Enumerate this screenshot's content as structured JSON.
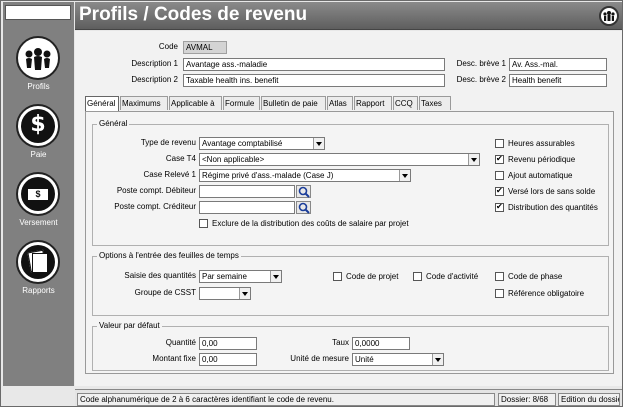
{
  "window": {
    "title": "Profils / Codes de revenu"
  },
  "sidebar": {
    "items": [
      {
        "label": "Profils",
        "icon": "people-icon"
      },
      {
        "label": "Paie",
        "icon": "dollar-icon"
      },
      {
        "label": "Versement",
        "icon": "banknote-icon"
      },
      {
        "label": "Rapports",
        "icon": "reports-icon"
      }
    ]
  },
  "header": {
    "code_label": "Code",
    "code_value": "AVMAL",
    "desc1_label": "Description 1",
    "desc1_value": "Avantage ass.-maladie",
    "desc2_label": "Description 2",
    "desc2_value": "Taxable health ins. benefit",
    "short1_label": "Desc. brève 1",
    "short1_value": "Av. Ass.-mal.",
    "short2_label": "Desc. brève 2",
    "short2_value": "Health benefit"
  },
  "tabs": [
    "Général",
    "Maximums",
    "Applicable à",
    "Formule",
    "Bulletin de paie",
    "Atlas",
    "Rapport",
    "CCQ",
    "Taxes"
  ],
  "general": {
    "title": "Général",
    "type_label": "Type de revenu",
    "type_value": "Avantage comptabilisé",
    "t4_label": "Case T4",
    "t4_value": "<Non applicable>",
    "releve_label": "Case Relevé 1",
    "releve_value": "Régime privé d'ass.-malade (Case J)",
    "debit_label": "Poste compt. Débiteur",
    "debit_value": "",
    "credit_label": "Poste compt. Créditeur",
    "credit_value": "",
    "exclude_label": "Exclure de la distribution des coûts de salaire par projet",
    "checks": [
      {
        "label": "Heures assurables",
        "checked": false
      },
      {
        "label": "Revenu périodique",
        "checked": true
      },
      {
        "label": "Ajout automatique",
        "checked": false
      },
      {
        "label": "Versé lors de sans solde",
        "checked": true
      },
      {
        "label": "Distribution des quantités",
        "checked": true
      }
    ]
  },
  "timesheet": {
    "title": "Options à l'entrée des feuilles de temps",
    "saisie_label": "Saisie des quantités",
    "saisie_value": "Par semaine",
    "csst_label": "Groupe de CSST",
    "csst_value": "",
    "projet_label": "Code de projet",
    "activite_label": "Code d'activité",
    "phase_label": "Code de phase",
    "reference_label": "Référence obligatoire"
  },
  "defaults": {
    "title": "Valeur par défaut",
    "quantite_label": "Quantité",
    "quantite_value": "0,00",
    "montant_label": "Montant fixe",
    "montant_value": "0,00",
    "taux_label": "Taux",
    "taux_value": "0,0000",
    "unite_label": "Unité de mesure",
    "unite_value": "Unité"
  },
  "status": {
    "hint": "Code alphanumérique de 2 à 6 caractères identifiant le code de revenu.",
    "dossier": "Dossier: 8/68",
    "mode": "Edition du dossie"
  }
}
